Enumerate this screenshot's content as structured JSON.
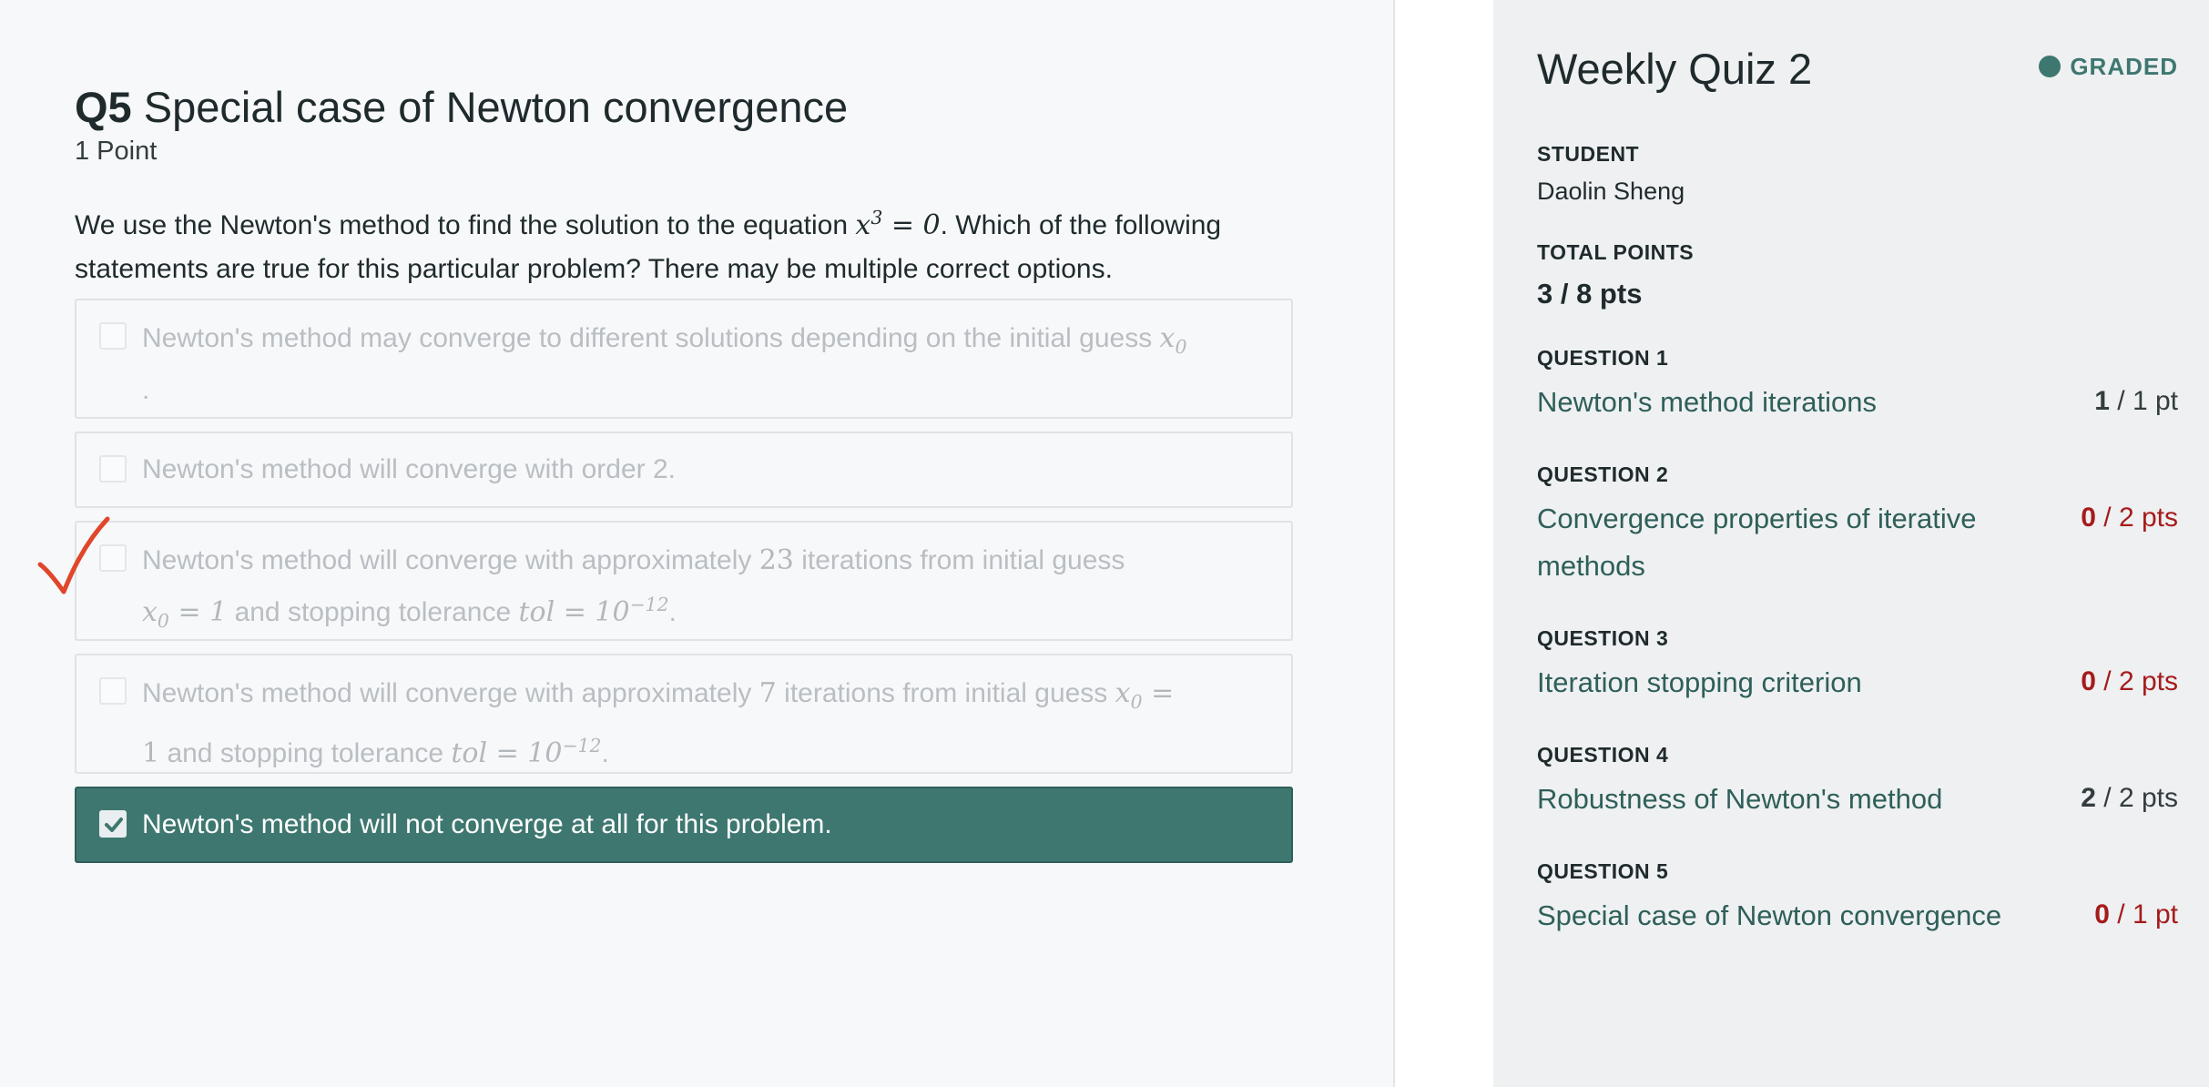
{
  "question": {
    "number": "Q5",
    "title": "Special case of Newton convergence",
    "points": "1 Point",
    "prompt_a": "We use the Newton's method to find the solution to the equation",
    "prompt_b": ". Which of the following statements are true for this particular problem? There may be multiple correct options."
  },
  "options": [
    {
      "text_a": "Newton's method may converge to different solutions depending on the initial guess",
      "text_b": ".",
      "checked": false
    },
    {
      "text_a": "Newton's method will converge with order 2.",
      "checked": false
    },
    {
      "text_a": "Newton's method will converge with approximately",
      "num": "23",
      "text_b": "iterations from initial guess",
      "text_c": "and stopping tolerance",
      "checked": false
    },
    {
      "text_a": "Newton's method will converge with approximately",
      "num": "7",
      "text_b": "iterations from initial guess",
      "text_c": "and stopping tolerance",
      "checked": false
    },
    {
      "text_a": "Newton's method will not converge at all for this problem.",
      "checked": true
    }
  ],
  "sidebar": {
    "quiz_title": "Weekly Quiz 2",
    "status": "GRADED",
    "student_label": "STUDENT",
    "student_name": "Daolin Sheng",
    "total_label": "TOTAL POINTS",
    "total_value": "3 / 8 pts",
    "questions": [
      {
        "label": "QUESTION 1",
        "title": "Newton's method iterations",
        "got": "1",
        "outof": "/ 1 pt"
      },
      {
        "label": "QUESTION 2",
        "title": "Convergence properties of iterative methods",
        "got": "0",
        "outof": "/ 2 pts"
      },
      {
        "label": "QUESTION 3",
        "title": "Iteration stopping criterion",
        "got": "0",
        "outof": "/ 2 pts"
      },
      {
        "label": "QUESTION 4",
        "title": "Robustness of Newton's method",
        "got": "2",
        "outof": "/ 2 pts"
      },
      {
        "label": "QUESTION 5",
        "title": "Special case of Newton convergence",
        "got": "0",
        "outof": "/ 1 pt"
      }
    ]
  },
  "colors": {
    "accent": "#3e7770",
    "error": "#a61b1b",
    "grader_mark": "#e0462a"
  },
  "icons": {
    "status_dot": "circle-icon",
    "checked_box": "checkmark-icon",
    "grader_mark": "check-mark-annotation-icon"
  }
}
